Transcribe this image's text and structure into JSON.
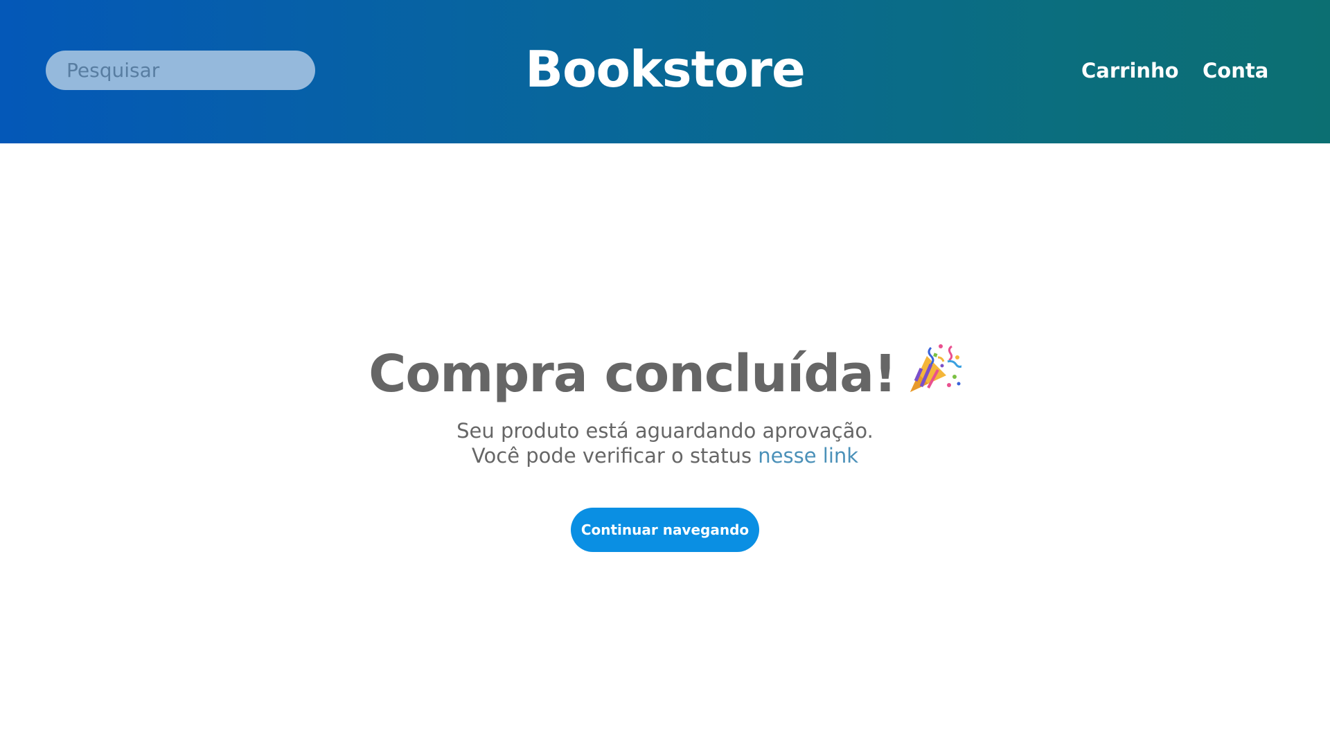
{
  "header": {
    "search_placeholder": "Pesquisar",
    "brand": "Bookstore",
    "nav": {
      "cart": "Carrinho",
      "account": "Conta"
    }
  },
  "main": {
    "title": "Compra concluída!",
    "title_icon": "party-popper-icon",
    "line1": "Seu produto está aguardando aprovação.",
    "line2_prefix": "Você pode verificar o status ",
    "status_link": "nesse link",
    "continue_button": "Continuar navegando"
  },
  "colors": {
    "header_gradient_start": "#0458b8",
    "header_gradient_end": "#0c6f72",
    "primary_button": "#0a8fe3",
    "link": "#4a90b8",
    "text": "#666666"
  }
}
